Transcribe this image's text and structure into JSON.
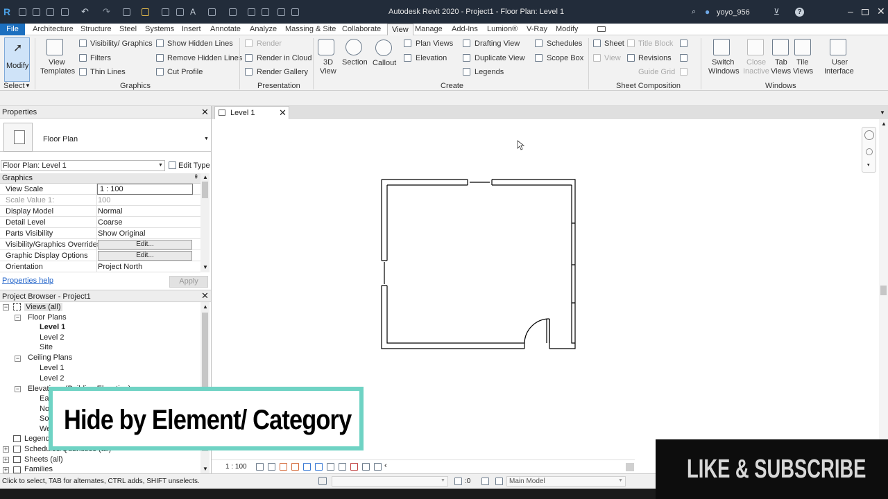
{
  "app": {
    "title": "Autodesk Revit 2020 - Project1 - Floor Plan: Level 1",
    "user": "yoyo_956"
  },
  "ribbon_tabs": [
    "File",
    "Architecture",
    "Structure",
    "Steel",
    "Systems",
    "Insert",
    "Annotate",
    "Analyze",
    "Massing & Site",
    "Collaborate",
    "View",
    "Manage",
    "Add-Ins",
    "Lumion®",
    "V-Ray",
    "Modify"
  ],
  "ribbon": {
    "modify": "Modify",
    "select": "Select",
    "view_templates": [
      "View",
      "Templates"
    ],
    "visibility_graphics": "Visibility/ Graphics",
    "filters": "Filters",
    "thin_lines": "Thin  Lines",
    "show_hidden_lines": "Show  Hidden Lines",
    "remove_hidden_lines": "Remove  Hidden Lines",
    "cut_profile": "Cut  Profile",
    "graphics_panel": "Graphics",
    "render": "Render",
    "render_in_cloud": "Render  in Cloud",
    "render_gallery": "Render  Gallery",
    "presentation_panel": "Presentation",
    "view_3d": [
      "3D",
      "View"
    ],
    "section": "Section",
    "callout": "Callout",
    "plan_views": "Plan  Views",
    "elevation": "Elevation",
    "drafting_view": "Drafting  View",
    "duplicate_view": "Duplicate  View",
    "legends": "Legends",
    "schedules": "Schedules",
    "scope_box": "Scope  Box",
    "create_panel": "Create",
    "sheet": "Sheet",
    "view": "View",
    "title_block": "Title  Block",
    "revisions": "Revisions",
    "guide_grid": "Guide  Grid",
    "sheet_composition_panel": "Sheet Composition",
    "switch_windows": [
      "Switch",
      "Windows"
    ],
    "close_inactive": [
      "Close",
      "Inactive"
    ],
    "tab_views": [
      "Tab",
      "Views"
    ],
    "tile_views": [
      "Tile",
      "Views"
    ],
    "user_interface": [
      "User",
      "Interface"
    ],
    "windows_panel": "Windows"
  },
  "properties": {
    "header": "Properties",
    "type_name": "Floor Plan",
    "instance_selector": "Floor Plan: Level 1",
    "edit_type": "Edit Type",
    "group": "Graphics",
    "rows": [
      {
        "key": "View Scale",
        "value": "1 : 100"
      },
      {
        "key": "Scale Value    1:",
        "value": "100"
      },
      {
        "key": "Display Model",
        "value": "Normal"
      },
      {
        "key": "Detail Level",
        "value": "Coarse"
      },
      {
        "key": "Parts Visibility",
        "value": "Show Original"
      },
      {
        "key": "Visibility/Graphics Overrides",
        "value": "Edit..."
      },
      {
        "key": "Graphic Display Options",
        "value": "Edit..."
      },
      {
        "key": "Orientation",
        "value": "Project North"
      }
    ],
    "help": "Properties help",
    "apply": "Apply"
  },
  "browser": {
    "header": "Project Browser - Project1",
    "views_all": "Views (all)",
    "floor_plans": "Floor Plans",
    "floor_plan_items": [
      "Level 1",
      "Level 2",
      "Site"
    ],
    "ceiling_plans": "Ceiling Plans",
    "ceiling_plan_items": [
      "Level 1",
      "Level 2"
    ],
    "elevations": "Elevations (Building Elevation)",
    "elevation_items": [
      "East",
      "North",
      "South",
      "West"
    ],
    "legends": "Legends",
    "schedules": "Schedules/Quantities (all)",
    "sheets": "Sheets (all)",
    "families": "Families"
  },
  "document": {
    "tab": "Level 1",
    "scale": "1 : 100"
  },
  "status": {
    "hint": "Click to select, TAB for alternates, CTRL adds, SHIFT unselects.",
    "zero": ":0",
    "model": "Main Model"
  },
  "overlay": {
    "caption": "Hide by Element/ Category",
    "subscribe": "LIKE & SUBSCRIBE"
  },
  "colors": {
    "title_bar": "#222c3a",
    "file_tab": "#1c6fbf",
    "caption_border": "#6fd3c4",
    "help_link": "#1f62c9"
  }
}
